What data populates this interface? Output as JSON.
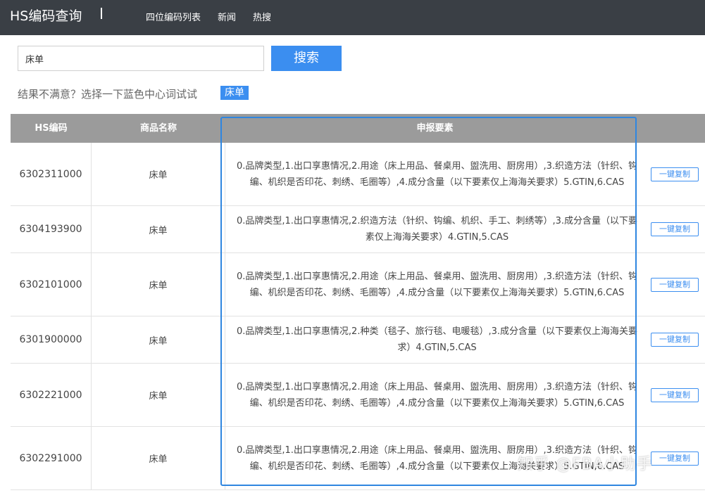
{
  "header": {
    "brand": "HS编码查询",
    "nav": [
      "四位编码列表",
      "新闻",
      "热搜"
    ]
  },
  "search": {
    "value": "床单",
    "button_label": "搜索"
  },
  "hint": {
    "text": "结果不满意？选择一下蓝色中心词试试",
    "keyword": "床单"
  },
  "table": {
    "columns": [
      "HS编码",
      "商品名称",
      "申报要素",
      ""
    ],
    "copy_label": "一键复制",
    "rows": [
      {
        "code": "6302311000",
        "name": "床单",
        "requirements": "0.品牌类型,1.出口享惠情况,2.用途（床上用品、餐桌用、盥洗用、厨房用）,3.织造方法（针织、钩编、机织是否印花、刺绣、毛圈等）,4.成分含量（以下要素仅上海海关要求）5.GTIN,6.CAS"
      },
      {
        "code": "6304193900",
        "name": "床单",
        "requirements": "0.品牌类型,1.出口享惠情况,2.织造方法（针织、钩编、机织、手工、刺绣等）,3.成分含量（以下要素仅上海海关要求）4.GTIN,5.CAS"
      },
      {
        "code": "6302101000",
        "name": "床单",
        "requirements": "0.品牌类型,1.出口享惠情况,2.用途（床上用品、餐桌用、盥洗用、厨房用）,3.织造方法（针织、钩编、机织是否印花、刺绣、毛圈等）,4.成分含量（以下要素仅上海海关要求）5.GTIN,6.CAS"
      },
      {
        "code": "6301900000",
        "name": "床单",
        "requirements": "0.品牌类型,1.出口享惠情况,2.种类（毯子、旅行毯、电暖毯）,3.成分含量（以下要素仅上海海关要求）4.GTIN,5.CAS"
      },
      {
        "code": "6302221000",
        "name": "床单",
        "requirements": "0.品牌类型,1.出口享惠情况,2.用途（床上用品、餐桌用、盥洗用、厨房用）,3.织造方法（针织、钩编、机织是否印花、刺绣、毛圈等）,4.成分含量（以下要素仅上海海关要求）5.GTIN,6.CAS"
      },
      {
        "code": "6302291000",
        "name": "床单",
        "requirements": "0.品牌类型,1.出口享惠情况,2.用途（床上用品、餐桌用、盥洗用、厨房用）,3.织造方法（针织、钩编、机织是否印花、刺绣、毛圈等）,4.成分含量（以下要素仅上海海关要求）5.GTIN,6.CAS"
      }
    ]
  },
  "watermark": "知乎 @FBA小助手"
}
